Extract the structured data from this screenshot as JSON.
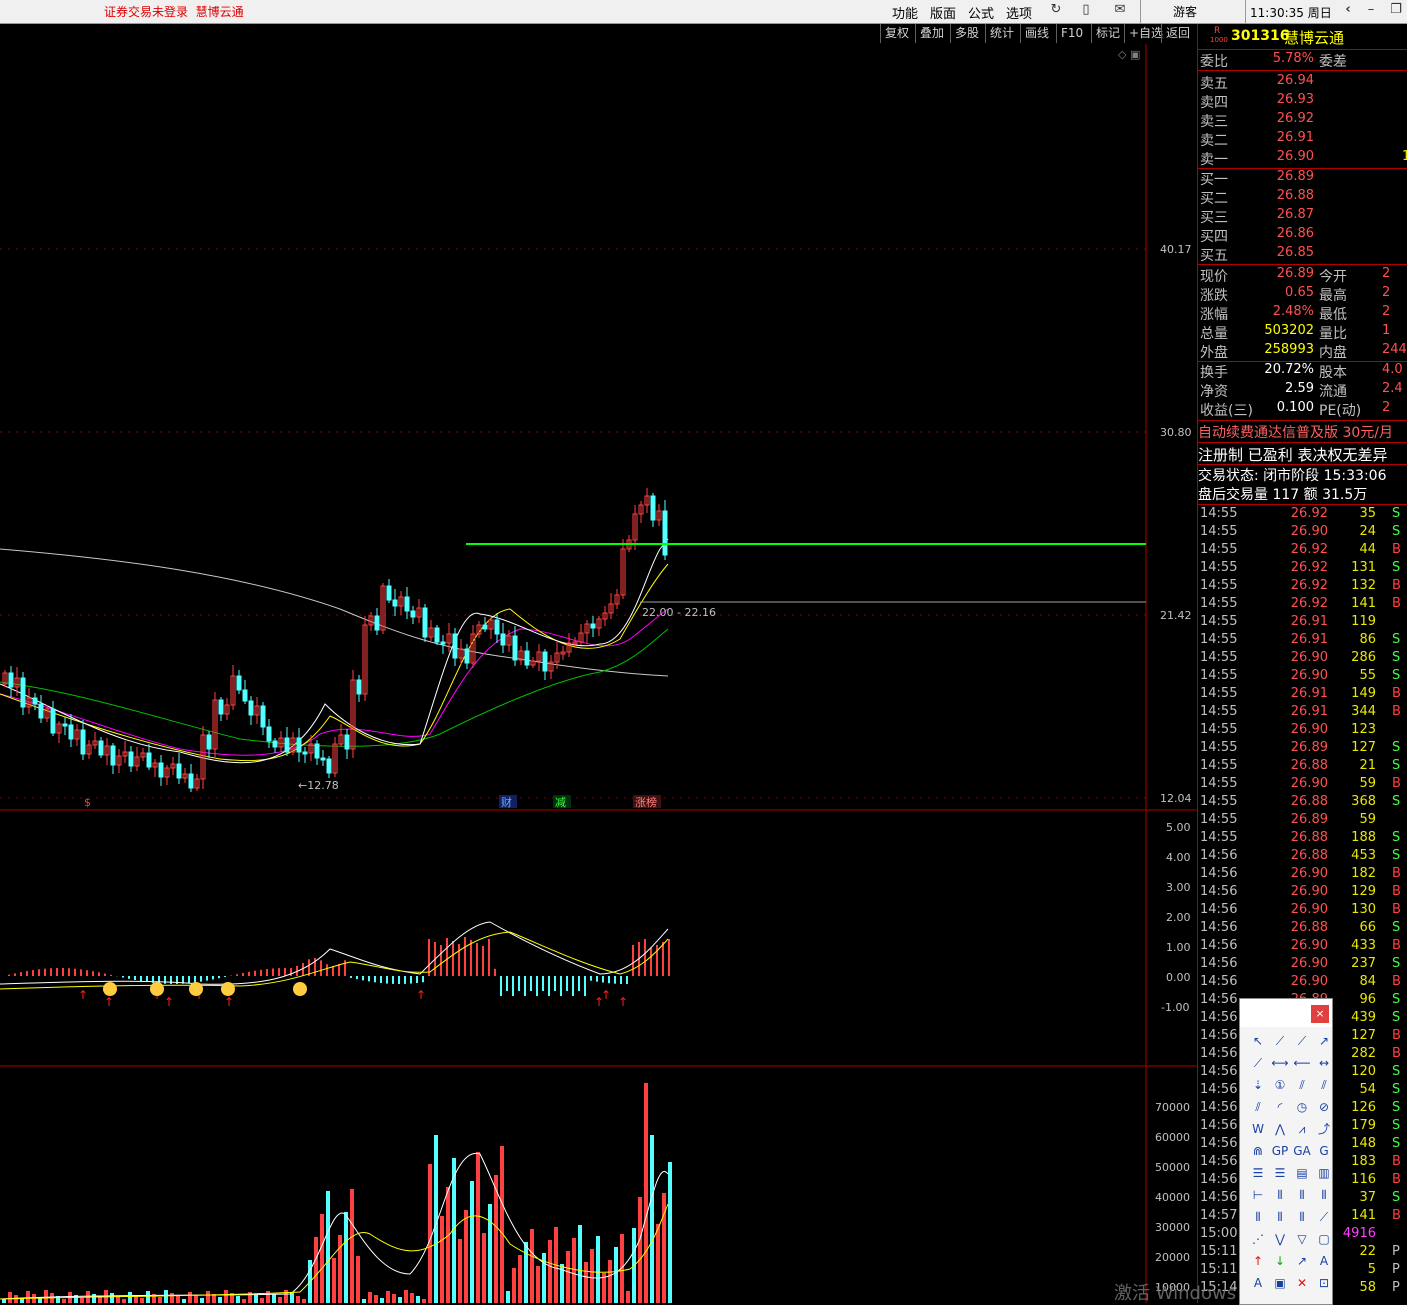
{
  "topbar": {
    "notice": "证券交易未登录  慧博云通",
    "menu": [
      "功能",
      "版面",
      "公式",
      "选项"
    ],
    "icons": [
      "refresh-icon",
      "phone-icon",
      "mail-icon"
    ],
    "user": "游客",
    "time": "11:30:35 周日",
    "controls": [
      "back-icon",
      "minimize-icon",
      "restore-icon"
    ]
  },
  "toolbar": [
    "复权",
    "叠加",
    "多股",
    "统计",
    "画线",
    "F10",
    "标记",
    "+自选",
    "返回"
  ],
  "chart_data": {
    "type": "candlestick",
    "price_axis": [
      "40.17",
      "30.80",
      "21.42",
      "12.04"
    ],
    "macd_axis": [
      "5.00",
      "4.00",
      "3.00",
      "2.00",
      "1.00",
      "0.00",
      "-1.00"
    ],
    "volume_axis": [
      "70000",
      "60000",
      "50000",
      "40000",
      "30000",
      "20000",
      "10000"
    ],
    "low_marker": "12.78",
    "range_label": "22.00 - 22.16",
    "event_marks": [
      "$",
      "财",
      "减",
      "涨榜"
    ]
  },
  "quote": {
    "badge": "R",
    "badge_sub": "1000",
    "code": "301316",
    "name": "慧博云通",
    "weibi_label": "委比",
    "weibi": "5.78%",
    "weicha_label": "委差",
    "sell": [
      {
        "l": "卖五",
        "p": "26.94"
      },
      {
        "l": "卖四",
        "p": "26.93"
      },
      {
        "l": "卖三",
        "p": "26.92"
      },
      {
        "l": "卖二",
        "p": "26.91"
      },
      {
        "l": "卖一",
        "p": "26.90"
      }
    ],
    "sell1_vol": "1",
    "buy": [
      {
        "l": "买一",
        "p": "26.89"
      },
      {
        "l": "买二",
        "p": "26.88"
      },
      {
        "l": "买三",
        "p": "26.87"
      },
      {
        "l": "买四",
        "p": "26.86"
      },
      {
        "l": "买五",
        "p": "26.85"
      }
    ],
    "stats": [
      {
        "l": "现价",
        "v": "26.89",
        "l2": "今开",
        "v2": "2"
      },
      {
        "l": "涨跌",
        "v": "0.65",
        "l2": "最高",
        "v2": "2"
      },
      {
        "l": "涨幅",
        "v": "2.48%",
        "l2": "最低",
        "v2": "2"
      },
      {
        "l": "总量",
        "v": "503202",
        "l2": "量比",
        "v2": "1"
      },
      {
        "l": "外盘",
        "v": "258993",
        "l2": "内盘",
        "v2": "244"
      }
    ],
    "stats2": [
      {
        "l": "换手",
        "v": "20.72%",
        "l2": "股本",
        "v2": "4.0"
      },
      {
        "l": "净资",
        "v": "2.59",
        "l2": "流通",
        "v2": "2.4"
      },
      {
        "l": "收益(三)",
        "v": "0.100",
        "l2": "PE(动)",
        "v2": "2"
      }
    ],
    "promo": "自动续费通达信普及版  30元/月",
    "tags": "注册制 已盈利 表决权无差异",
    "status": "交易状态: 闭市阶段 15:33:06",
    "after_hours": "盘后交易量 117 额 31.5万"
  },
  "ticks": [
    [
      "14:55",
      "26.92",
      "35",
      "S"
    ],
    [
      "14:55",
      "26.90",
      "24",
      "S"
    ],
    [
      "14:55",
      "26.92",
      "44",
      "B"
    ],
    [
      "14:55",
      "26.92",
      "131",
      "S"
    ],
    [
      "14:55",
      "26.92",
      "132",
      "B"
    ],
    [
      "14:55",
      "26.92",
      "141",
      "B"
    ],
    [
      "14:55",
      "26.91",
      "119",
      ""
    ],
    [
      "14:55",
      "26.91",
      "86",
      "S"
    ],
    [
      "14:55",
      "26.90",
      "286",
      "S"
    ],
    [
      "14:55",
      "26.90",
      "55",
      "S"
    ],
    [
      "14:55",
      "26.91",
      "149",
      "B"
    ],
    [
      "14:55",
      "26.91",
      "344",
      "B"
    ],
    [
      "14:55",
      "26.90",
      "123",
      ""
    ],
    [
      "14:55",
      "26.89",
      "127",
      "S"
    ],
    [
      "14:55",
      "26.88",
      "21",
      "S"
    ],
    [
      "14:55",
      "26.90",
      "59",
      "B"
    ],
    [
      "14:55",
      "26.88",
      "368",
      "S"
    ],
    [
      "14:55",
      "26.89",
      "59",
      ""
    ],
    [
      "14:55",
      "26.88",
      "188",
      "S"
    ],
    [
      "14:56",
      "26.88",
      "453",
      "S"
    ],
    [
      "14:56",
      "26.90",
      "182",
      "B"
    ],
    [
      "14:56",
      "26.90",
      "129",
      "B"
    ],
    [
      "14:56",
      "26.90",
      "130",
      "B"
    ],
    [
      "14:56",
      "26.88",
      "66",
      "S"
    ],
    [
      "14:56",
      "26.90",
      "433",
      "B"
    ],
    [
      "14:56",
      "26.90",
      "237",
      "S"
    ],
    [
      "14:56",
      "26.90",
      "84",
      "B"
    ],
    [
      "14:56",
      "26.89",
      "96",
      "S"
    ],
    [
      "14:56",
      "",
      "439",
      "S"
    ],
    [
      "14:56",
      "",
      "127",
      "B"
    ],
    [
      "14:56",
      "",
      "282",
      "B"
    ],
    [
      "14:56",
      "",
      "120",
      "S"
    ],
    [
      "14:56",
      "",
      "54",
      "S"
    ],
    [
      "14:56",
      "",
      "126",
      "S"
    ],
    [
      "14:56",
      "",
      "179",
      "S"
    ],
    [
      "14:56",
      "",
      "148",
      "S"
    ],
    [
      "14:56",
      "",
      "183",
      "B"
    ],
    [
      "14:56",
      "",
      "116",
      "B"
    ],
    [
      "14:56",
      "",
      "37",
      "S"
    ],
    [
      "14:57",
      "",
      "141",
      "B"
    ],
    [
      "15:00",
      "",
      "4916",
      ""
    ],
    [
      "15:11",
      "",
      "22",
      "P"
    ],
    [
      "15:11",
      "",
      "5",
      "P"
    ],
    [
      "15:14",
      "",
      "58",
      "P"
    ]
  ],
  "drawing_palette": {
    "close": "×"
  },
  "watermark": "激活 Windows",
  "colors": {
    "up": "#ff4040",
    "down": "#54ffff",
    "accent_red": "#b00000",
    "ma_white": "#ffffff",
    "ma_yellow": "#ffff00",
    "ma_magenta": "#ff00ff",
    "ma_green": "#00c000",
    "resistance": "#00ff00"
  }
}
